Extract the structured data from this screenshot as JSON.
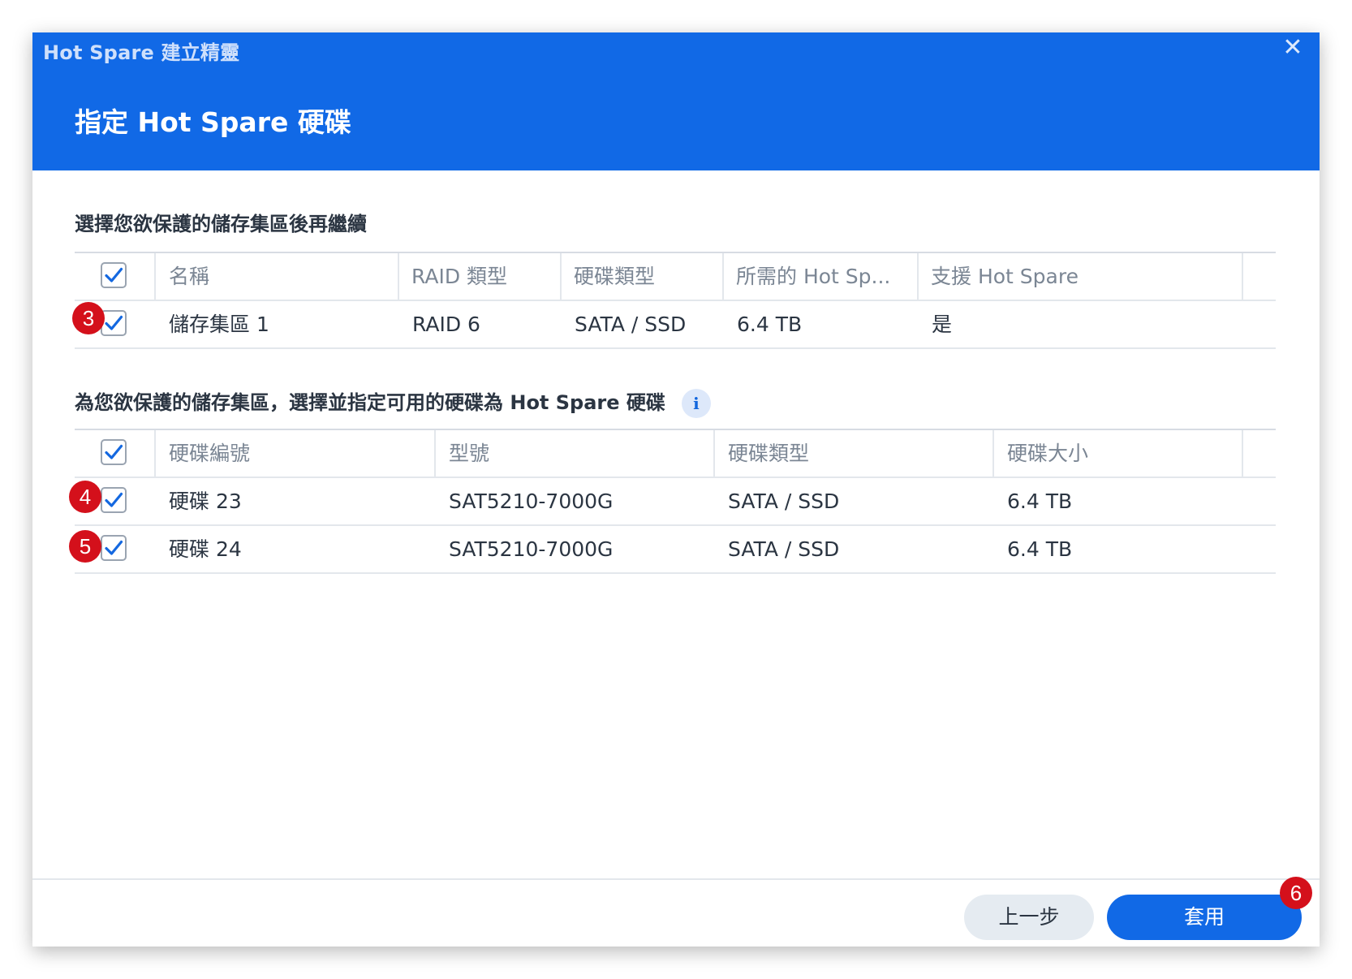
{
  "window": {
    "title": "Hot Spare 建立精靈",
    "close_label": "✕"
  },
  "step": {
    "title": "指定 Hot Spare 硬碟"
  },
  "pools_section": {
    "title": "選擇您欲保護的儲存集區後再繼續",
    "columns": [
      "名稱",
      "RAID 類型",
      "硬碟類型",
      "所需的 Hot Sp...",
      "支援 Hot Spare"
    ],
    "rows": [
      {
        "checked": true,
        "cells": [
          "儲存集區 1",
          "RAID 6",
          "SATA / SSD",
          "6.4 TB",
          "是"
        ]
      }
    ]
  },
  "drives_section": {
    "title": "為您欲保護的儲存集區，選擇並指定可用的硬碟為 Hot Spare 硬碟",
    "info_icon": "i",
    "columns": [
      "硬碟編號",
      "型號",
      "硬碟類型",
      "硬碟大小"
    ],
    "rows": [
      {
        "checked": true,
        "cells": [
          "硬碟 23",
          "SAT5210-7000G",
          "SATA / SSD",
          "6.4 TB"
        ]
      },
      {
        "checked": true,
        "cells": [
          "硬碟 24",
          "SAT5210-7000G",
          "SATA / SSD",
          "6.4 TB"
        ]
      }
    ]
  },
  "annotations": [
    "3",
    "4",
    "5",
    "6"
  ],
  "footer": {
    "prev_label": "上一步",
    "apply_label": "套用"
  },
  "colors": {
    "primary": "#1169e6",
    "badge": "#d4101b",
    "check": "#1468e0"
  }
}
